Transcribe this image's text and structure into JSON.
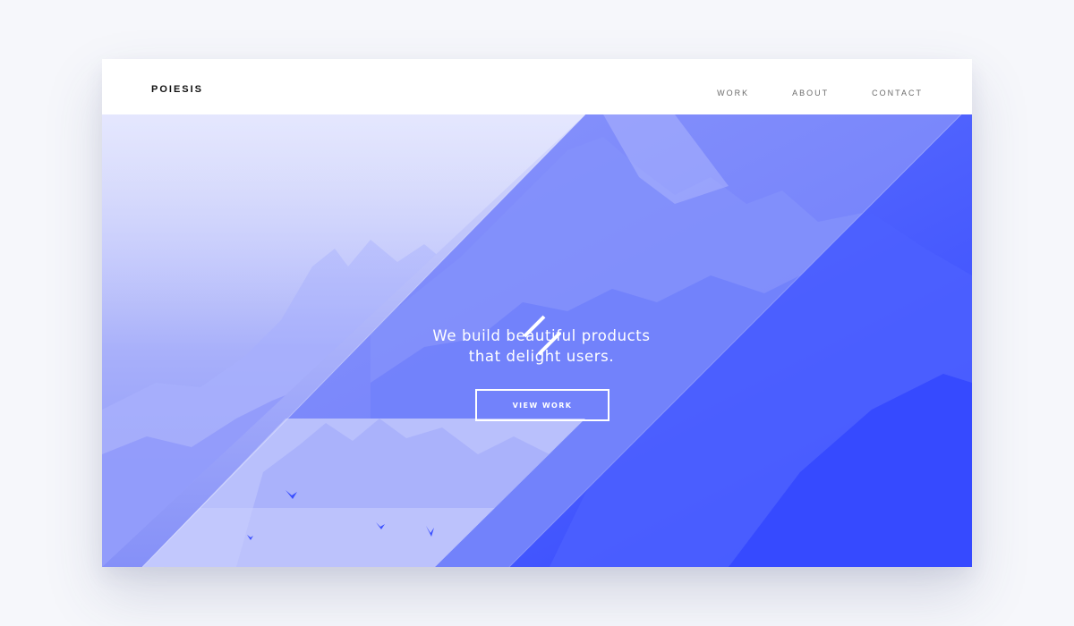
{
  "header": {
    "logo": "POIESIS",
    "nav": [
      {
        "label": "WORK"
      },
      {
        "label": "ABOUT"
      },
      {
        "label": "CONTACT"
      }
    ]
  },
  "hero": {
    "icon": "double-slash-logo-icon",
    "headline_line1": "We build beautiful products",
    "headline_line2": "that delight users.",
    "cta_label": "VIEW WORK"
  },
  "colors": {
    "page_background": "#f6f7fb",
    "header_background": "#ffffff",
    "hero_light": "#cfd3fb",
    "hero_mid": "#7f8dfa",
    "hero_deep": "#3a4fff",
    "text_on_hero": "#ffffff"
  }
}
